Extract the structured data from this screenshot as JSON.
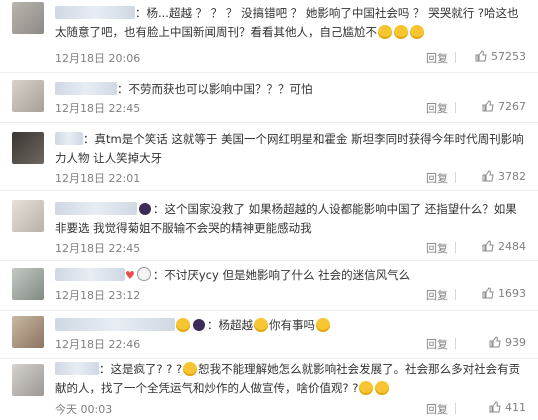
{
  "colors": {
    "text": "#333333",
    "meta": "#808080",
    "divider": "#eeeeee",
    "emoji": "#f7c531"
  },
  "comments": [
    {
      "text": "：杨...超越 ？ ？ ？ 没搞错吧 ？ 她影响了中国社会吗 ？ 哭哭就行 ?哈这也太随意了吧，也有脸上中国新闻周刊？看看其他人，自己尴尬不",
      "time": "12月18日 20:06",
      "reply": "回复",
      "likes": "57253"
    },
    {
      "text": "：不劳而获也可以影响中国？？？可怕",
      "time": "12月18日 22:45",
      "reply": "回复",
      "likes": "7267"
    },
    {
      "text": "：真tm是个笑话 这就等于 美国一个网红明星和霍金 斯坦李同时获得今年时代周刊影响力人物 让人笑掉大牙",
      "time": "12月18日 22:01",
      "reply": "回复",
      "likes": "3782"
    },
    {
      "text": "：这个国家没救了 如果杨超越的人设都能影响中国了 还指望什么？如果非要选 我觉得菊姐不服输不会哭的精神更能感动我",
      "time": "12月18日 22:45",
      "reply": "回复",
      "likes": "2484"
    },
    {
      "text": "：不讨厌ycy 但是她影响了什么 社会的迷信风气么",
      "time": "12月18日 23:12",
      "reply": "回复",
      "likes": "1693"
    },
    {
      "text": "：杨超越",
      "text2": "你有事吗",
      "time": "12月18日 22:46",
      "reply": "回复",
      "likes": "939"
    },
    {
      "text": "：这是疯了? ? ?",
      "text2": "恕我不能理解她怎么就影响社会发展了。社会那么多对社会有贡献的人，找了一个全凭运气和炒作的人做宣传，啥价值观? ?",
      "time": "今天 00:03",
      "reply": "回复",
      "likes": "411"
    }
  ]
}
